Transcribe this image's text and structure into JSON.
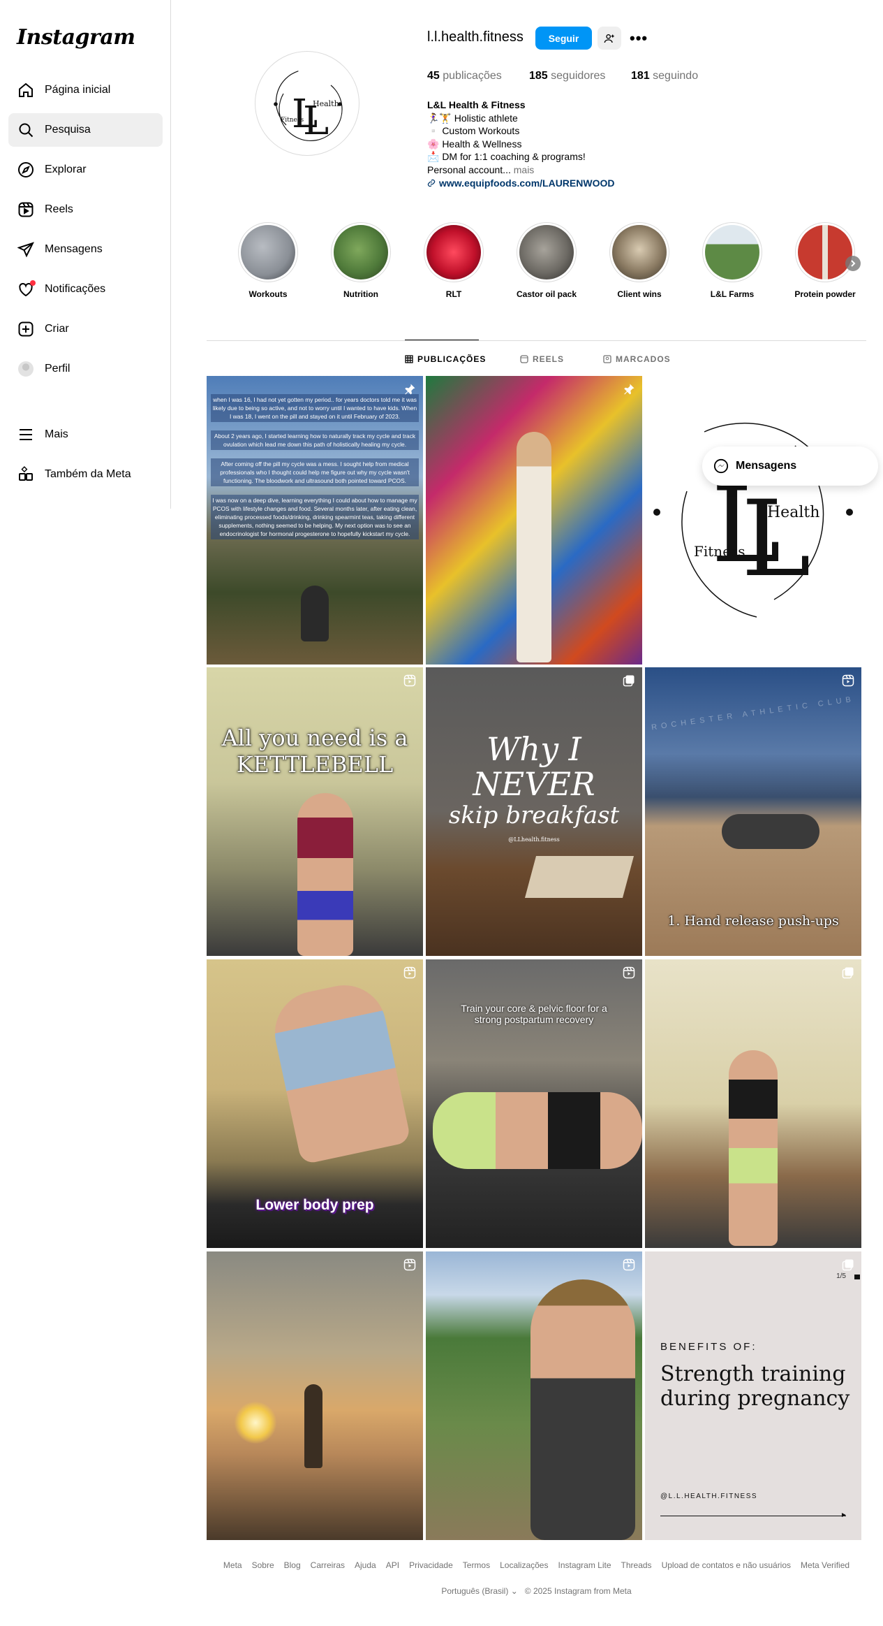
{
  "app": {
    "logo": "Instagram"
  },
  "sidebar": {
    "items": [
      {
        "label": "Página inicial",
        "icon": "home-icon"
      },
      {
        "label": "Pesquisa",
        "icon": "search-icon"
      },
      {
        "label": "Explorar",
        "icon": "compass-icon"
      },
      {
        "label": "Reels",
        "icon": "reels-icon"
      },
      {
        "label": "Mensagens",
        "icon": "send-icon"
      },
      {
        "label": "Notificações",
        "icon": "heart-icon"
      },
      {
        "label": "Criar",
        "icon": "plus-square-icon"
      },
      {
        "label": "Perfil",
        "icon": "avatar"
      },
      {
        "label": "Mais",
        "icon": "menu-icon"
      },
      {
        "label": "Também da Meta",
        "icon": "meta-apps-icon"
      }
    ]
  },
  "profile": {
    "username": "l.l.health.fitness",
    "follow_label": "Seguir",
    "stats": [
      {
        "count": "45",
        "label": "publicações"
      },
      {
        "count": "185",
        "label": "seguidores"
      },
      {
        "count": "181",
        "label": "seguindo"
      }
    ],
    "bio": {
      "name": "L&L Health & Fitness",
      "lines": [
        "🏃‍♀️🏋️ Holistic athlete",
        "▫️ Custom Workouts",
        "🌸 Health & Wellness",
        "📩 DM for 1:1 coaching & programs!"
      ],
      "truncated": "Personal account...",
      "more": "mais",
      "link": "www.equipfoods.com/LAURENWOOD"
    },
    "logo": {
      "letters": "LL",
      "word1": "Health",
      "word2": "Fitness"
    }
  },
  "highlights": [
    {
      "label": "Workouts",
      "color": "#8a8f96"
    },
    {
      "label": "Nutrition",
      "color": "#4f7a3a"
    },
    {
      "label": "RLT",
      "color": "#c0102a"
    },
    {
      "label": "Castor oil pack",
      "color": "#6d6a64"
    },
    {
      "label": "Client wins",
      "color": "#8a7a62"
    },
    {
      "label": "L&L Farms",
      "color": "#5d8a45"
    },
    {
      "label": "Protein powder",
      "color": "#c73a2f"
    }
  ],
  "tabs": [
    {
      "label": "PUBLICAÇÕES",
      "icon": "grid-icon"
    },
    {
      "label": "REELS",
      "icon": "reels-tab-icon"
    },
    {
      "label": "MARCADOS",
      "icon": "tagged-icon"
    }
  ],
  "posts": {
    "p1": {
      "paragraphs": [
        "when I was 16, I had not yet gotten my period.. for years doctors told me it was likely due to being so active, and not to worry until I wanted to have kids. When I was 18, I went on the pill and stayed on it until February of 2023.",
        "About 2 years ago, I started learning how to naturally track my cycle and track ovulation which lead me down this path of holistically healing my cycle.",
        "After coming off the pill my cycle was a mess. I sought help from medical professionals who I thought could help me figure out why my cycle wasn't functioning. The bloodwork and ultrasound both pointed toward PCOS.",
        "I was now on a deep dive, learning everything I could about how to manage my PCOS with lifestyle changes and food. Several months later, after eating clean, eliminating processed foods/drinking, drinking spearmint teas, taking different supplements, nothing seemed to be helping. My next option was to see an endocrinologist for hormonal progesterone to hopefully kickstart my cycle."
      ]
    },
    "p4": {
      "line1": "All you need is a",
      "line2": "KETTLEBELL"
    },
    "p5": {
      "line1": "Why I NEVER",
      "line2": "skip breakfast",
      "handle": "@LLhealth.fitness"
    },
    "p6": {
      "caption": "1. Hand release push-ups",
      "wall": "ROCHESTER ATHLETIC CLUB"
    },
    "p7": {
      "caption": "Lower body prep"
    },
    "p8": {
      "caption": "Train your core & pelvic floor for a strong postpartum recovery"
    },
    "p12": {
      "counter": "1/5",
      "kicker": "BENEFITS OF:",
      "title1": "Strength training",
      "title2": "during pregnancy",
      "handle": "@L.L.HEALTH.FITNESS"
    }
  },
  "floating_messages": {
    "label": "Mensagens"
  },
  "footer": {
    "links": [
      "Meta",
      "Sobre",
      "Blog",
      "Carreiras",
      "Ajuda",
      "API",
      "Privacidade",
      "Termos",
      "Localizações",
      "Instagram Lite",
      "Threads",
      "Upload de contatos e não usuários",
      "Meta Verified"
    ],
    "language": "Português (Brasil)",
    "copyright": "© 2025 Instagram from Meta"
  }
}
